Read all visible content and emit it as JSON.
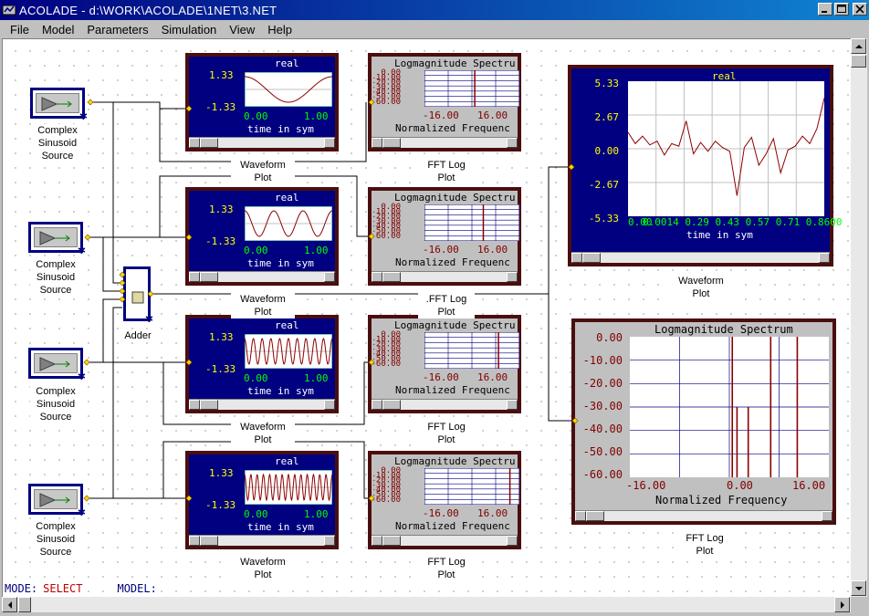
{
  "window": {
    "title": "ACOLADE - d:\\WORK\\ACOLADE\\1NET\\3.NET"
  },
  "menu": {
    "file": "File",
    "model": "Model",
    "parameters": "Parameters",
    "simulation": "Simulation",
    "view": "View",
    "help": "Help"
  },
  "sources": [
    {
      "line1": "Complex",
      "line2": "Sinusoid",
      "line3": "Source"
    },
    {
      "line1": "Complex",
      "line2": "Sinusoid",
      "line3": "Source"
    },
    {
      "line1": "Complex",
      "line2": "Sinusoid",
      "line3": "Source"
    },
    {
      "line1": "Complex",
      "line2": "Sinusoid",
      "line3": "Source"
    }
  ],
  "adder": {
    "label": "Adder"
  },
  "wave_plots": [
    {
      "title": "real",
      "ymax": "1.33",
      "ymin": "-1.33",
      "xmin": "0.00",
      "xmax": "1.00",
      "xlabel": "time in sym",
      "cap1": "Waveform",
      "cap2": "Plot",
      "cycles": 0.5
    },
    {
      "title": "real",
      "ymax": "1.33",
      "ymin": "-1.33",
      "xmin": "0.00",
      "xmax": "1.00",
      "xlabel": "time in sym",
      "cap1": "Waveform",
      "cap2": "Plot",
      "cycles": 3
    },
    {
      "title": "real",
      "ymax": "1.33",
      "ymin": "-1.33",
      "xmin": "0.00",
      "xmax": "1.00",
      "xlabel": "time in sym",
      "cap1": "Waveform",
      "cap2": "Plot",
      "cycles": 10
    },
    {
      "title": "real",
      "ymax": "1.33",
      "ymin": "-1.33",
      "xmin": "0.00",
      "xmax": "1.00",
      "xlabel": "time in sym",
      "cap1": "Waveform",
      "cap2": "Plot",
      "cycles": 14
    }
  ],
  "fft_plots": [
    {
      "title": "Logmagnitude Spectru",
      "y0": "0.00",
      "y1": "-10.00",
      "y2": "-20.00",
      "y3": "-30.00",
      "y4": "-40.00",
      "y5": "-50.00",
      "y6": "-60.00",
      "xmin": "-16.00",
      "xmax": "16.00",
      "xlabel": "Normalized Frequenc",
      "cap1": "FFT Log",
      "cap2": "Plot",
      "spike": 0.53
    },
    {
      "title": "Logmagnitude Spectru",
      "y0": "0.00",
      "y1": "-10.00",
      "y2": "-20.00",
      "y3": "-30.00",
      "y4": "-40.00",
      "y5": "-50.00",
      "y6": "-60.00",
      "xmin": "-16.00",
      "xmax": "16.00",
      "xlabel": "Normalized Frequenc",
      "cap1": ".FFT Log",
      "cap2": "Plot",
      "spike": 0.62
    },
    {
      "title": "Logmagnitude Spectru",
      "y0": "0.00",
      "y1": "-10.00",
      "y2": "-20.00",
      "y3": "-30.00",
      "y4": "-40.00",
      "y5": "-50.00",
      "y6": "-60.00",
      "xmin": "-16.00",
      "xmax": "16.00",
      "xlabel": "Normalized Frequenc",
      "cap1": "FFT Log",
      "cap2": "Plot",
      "spike": 0.78
    },
    {
      "title": "Logmagnitude Spectru",
      "y0": "0.00",
      "y1": "-10.00",
      "y2": "-20.00",
      "y3": "-30.00",
      "y4": "-40.00",
      "y5": "-50.00",
      "y6": "-60.00",
      "xmin": "-16.00",
      "xmax": "16.00",
      "xlabel": "Normalized Frequenc",
      "cap1": "FFT Log",
      "cap2": "Plot",
      "spike": 0.9
    }
  ],
  "big_wave": {
    "title": "real",
    "yticks": [
      "5.33",
      "2.67",
      "0.00",
      "-2.67",
      "-5.33"
    ],
    "xticks": "0.0014 0.29 0.43 0.57 0.71 0.8600",
    "xtick0": "0.00",
    "xlabel": "time in sym",
    "cap1": "Waveform",
    "cap2": "Plot",
    "values": [
      1.3,
      0.4,
      1.0,
      0.3,
      0.6,
      -0.5,
      0.4,
      0.2,
      2.2,
      -0.4,
      0.5,
      -0.2,
      0.6,
      0.1,
      -0.2,
      -3.7,
      0.1,
      0.9,
      -1.3,
      -0.4,
      0.8,
      -1.9,
      -0.1,
      0.2,
      1.0,
      0.4,
      1.6,
      4.0
    ]
  },
  "big_fft": {
    "title": "Logmagnitude Spectrum",
    "yticks": [
      "0.00",
      "-10.00",
      "-20.00",
      "-30.00",
      "-40.00",
      "-50.00",
      "-60.00"
    ],
    "xticks": [
      "-16.00",
      "0.00",
      "16.00"
    ],
    "xlabel": "Normalized Frequency",
    "cap1": "FFT Log",
    "cap2": "Plot",
    "spikes": [
      0.5,
      1.3,
      3.2,
      7.0,
      11.5
    ]
  },
  "status": {
    "mode_key": "MODE:",
    "mode_val": "SELECT",
    "model_key": "MODEL:"
  },
  "colors": {
    "plot_bg": "#000080",
    "plot_border": "#4a0e0e",
    "trace": "#8b0000",
    "wire": "#000000",
    "port": "#ffd700"
  }
}
